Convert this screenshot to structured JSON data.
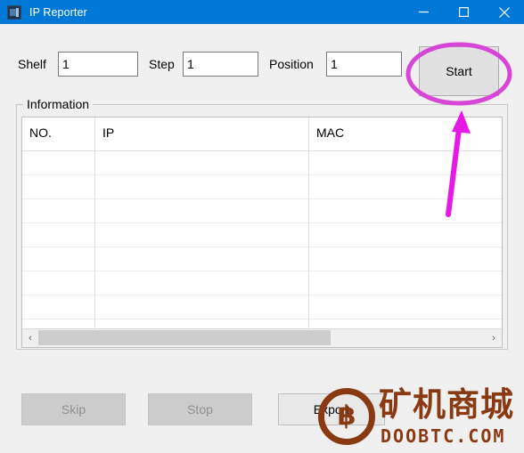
{
  "window": {
    "title": "IP Reporter",
    "icon": "app-icon",
    "controls": {
      "minimize": "minimize-icon",
      "maximize": "maximize-icon",
      "close": "close-icon"
    }
  },
  "form": {
    "shelf": {
      "label": "Shelf",
      "value": "1"
    },
    "step": {
      "label": "Step",
      "value": "1"
    },
    "position": {
      "label": "Position",
      "value": "1"
    },
    "start_button": "Start"
  },
  "information": {
    "group_label": "Information",
    "columns": [
      "NO.",
      "IP",
      "MAC"
    ],
    "rows": [],
    "row_count": 9,
    "scrollbar": {
      "left_arrow": "‹",
      "right_arrow": "›"
    }
  },
  "footer": {
    "buttons": [
      {
        "label": "Skip",
        "enabled": false
      },
      {
        "label": "Stop",
        "enabled": false
      },
      {
        "label": "Export",
        "enabled": true
      }
    ]
  },
  "annotations": {
    "highlight_ellipse": {
      "target": "Start",
      "color": "#d846d8"
    },
    "arrow": {
      "target": "Start",
      "color": "#e619e6"
    }
  },
  "watermark": {
    "logo_glyph": "฿",
    "cn_text": "矿机商城",
    "domain": "DOOBTC.COM",
    "color": "#8a3a12"
  }
}
